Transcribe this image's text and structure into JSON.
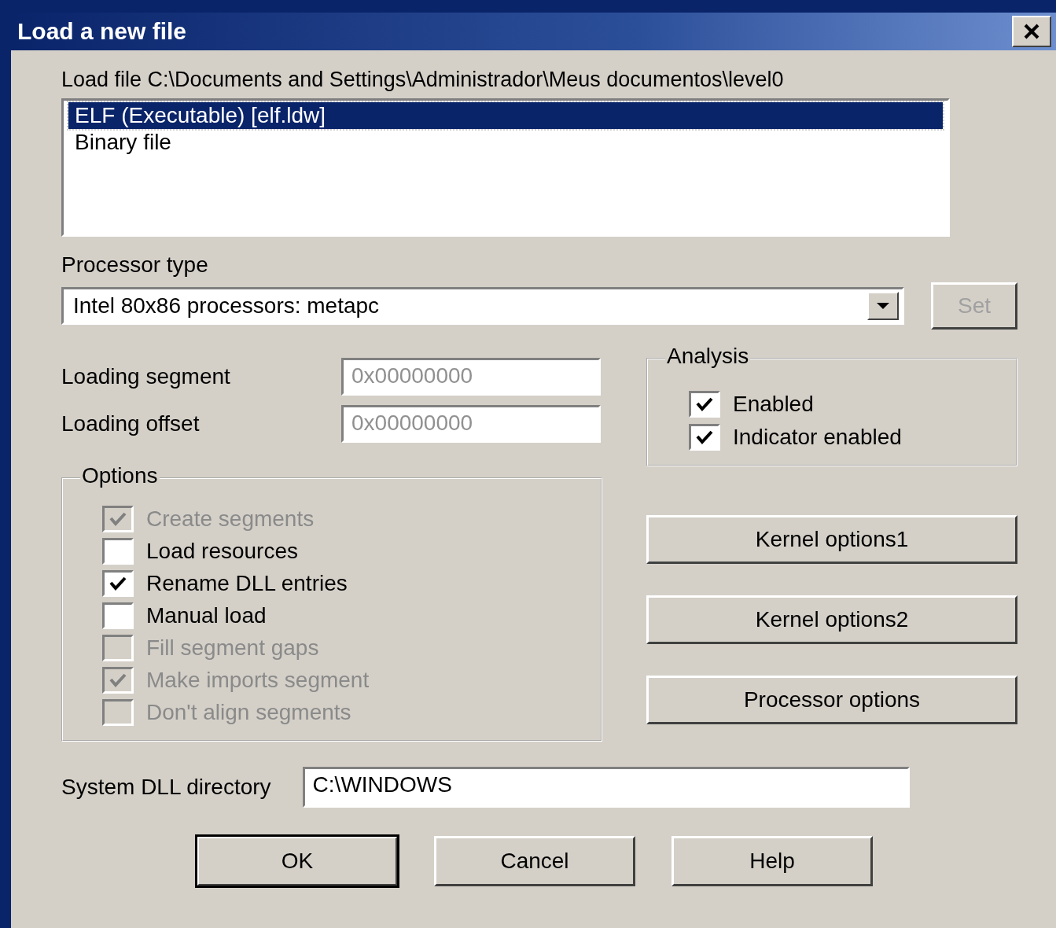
{
  "window": {
    "title": "Load a new file"
  },
  "load_file_label": "Load file C:\\Documents and Settings\\Administrador\\Meus documentos\\level0",
  "file_types": [
    {
      "label": "ELF (Executable) [elf.ldw]",
      "selected": true
    },
    {
      "label": "Binary file",
      "selected": false
    }
  ],
  "processor_type": {
    "label": "Processor type",
    "value": "Intel 80x86 processors: metapc"
  },
  "set_button": {
    "label": "Set",
    "disabled": true
  },
  "loading_segment": {
    "label": "Loading segment",
    "value": "0x00000000",
    "disabled": true
  },
  "loading_offset": {
    "label": "Loading offset",
    "value": "0x00000000",
    "disabled": true
  },
  "analysis": {
    "title": "Analysis",
    "items": [
      {
        "label": "Enabled",
        "checked": true,
        "disabled": false
      },
      {
        "label": "Indicator enabled",
        "checked": true,
        "disabled": false
      }
    ]
  },
  "options": {
    "title": "Options",
    "items": [
      {
        "label": "Create segments",
        "checked": true,
        "disabled": true
      },
      {
        "label": "Load resources",
        "checked": false,
        "disabled": false
      },
      {
        "label": "Rename DLL entries",
        "checked": true,
        "disabled": false
      },
      {
        "label": "Manual load",
        "checked": false,
        "disabled": false
      },
      {
        "label": "Fill segment gaps",
        "checked": false,
        "disabled": true
      },
      {
        "label": "Make imports segment",
        "checked": true,
        "disabled": true
      },
      {
        "label": "Don't align segments",
        "checked": false,
        "disabled": true
      }
    ]
  },
  "side_buttons": [
    "Kernel options1",
    "Kernel options2",
    "Processor options"
  ],
  "system_dll_directory": {
    "label": "System DLL directory",
    "value": "C:\\WINDOWS"
  },
  "buttons": [
    {
      "label": "OK",
      "default": true
    },
    {
      "label": "Cancel",
      "default": false
    },
    {
      "label": "Help",
      "default": false
    }
  ]
}
